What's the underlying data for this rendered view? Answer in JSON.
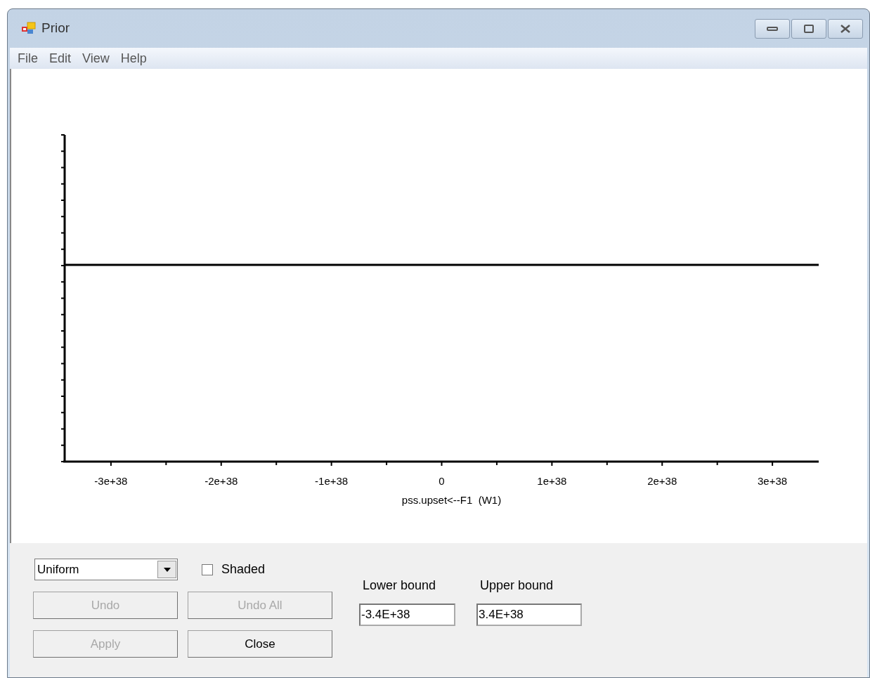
{
  "window": {
    "title": "Prior"
  },
  "menu": [
    "File",
    "Edit",
    "View",
    "Help"
  ],
  "chart": {
    "tick_labels": [
      "-3e+38",
      "-2e+38",
      "-1e+38",
      "0",
      "1e+38",
      "2e+38",
      "3e+38"
    ],
    "axis_label": "pss.upset<--F1  (W1)"
  },
  "distribution": {
    "value": "Uniform"
  },
  "shaded": {
    "label": "Shaded",
    "checked": false
  },
  "buttons": [
    {
      "label": "Undo",
      "disabled": true
    },
    {
      "label": "Undo All",
      "disabled": true
    },
    {
      "label": "Apply",
      "disabled": true
    },
    {
      "label": "Close",
      "disabled": false
    }
  ],
  "bounds": [
    {
      "label": "Lower bound",
      "value": "-3.4E+38"
    },
    {
      "label": "Upper bound",
      "value": "3.4E+38"
    }
  ]
}
